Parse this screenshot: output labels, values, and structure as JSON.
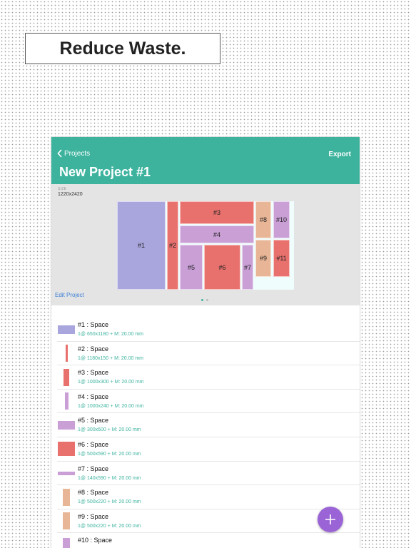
{
  "headline": "Reduce Waste.",
  "nav": {
    "back_label": "Projects",
    "export_label": "Export",
    "title": "New Project #1"
  },
  "preview": {
    "size_caption": "SIZE",
    "size_value": "1220x2420",
    "edit_label": "Edit Project",
    "pager_pages": 2,
    "active_page": 1
  },
  "colors": {
    "accent": "#3db39e",
    "purple": "#a9a5dd",
    "red": "#e8716d",
    "lilac": "#c99fd6",
    "peach": "#e8b596",
    "fab": "#9b64d6"
  },
  "pieces": [
    {
      "label": "#1",
      "color": "#a9a5dd"
    },
    {
      "label": "#2",
      "color": "#e8716d"
    },
    {
      "label": "#3",
      "color": "#e8716d"
    },
    {
      "label": "#4",
      "color": "#c99fd6"
    },
    {
      "label": "#5",
      "color": "#c99fd6"
    },
    {
      "label": "#6",
      "color": "#e8716d"
    },
    {
      "label": "#7",
      "color": "#c99fd6"
    },
    {
      "label": "#8",
      "color": "#e8b596"
    },
    {
      "label": "#9",
      "color": "#e8b596"
    },
    {
      "label": "#10",
      "color": "#c99fd6"
    },
    {
      "label": "#11",
      "color": "#e8716d"
    }
  ],
  "items": [
    {
      "title": "#1 : Space",
      "detail": "1@ 650x1180 + M: 20.00 mm",
      "color": "#a9a5dd"
    },
    {
      "title": "#2 : Space",
      "detail": "1@ 1180x150 + M: 20.00 mm",
      "color": "#e8716d"
    },
    {
      "title": "#3 : Space",
      "detail": "1@ 1000x300 + M: 20.00 mm",
      "color": "#e8716d"
    },
    {
      "title": "#4 : Space",
      "detail": "1@ 1000x240 + M: 20.00 mm",
      "color": "#c99fd6"
    },
    {
      "title": "#5 : Space",
      "detail": "1@ 300x600 + M: 20.00 mm",
      "color": "#c99fd6"
    },
    {
      "title": "#6 : Space",
      "detail": "1@ 500x590 + M: 20.00 mm",
      "color": "#e8716d"
    },
    {
      "title": "#7 : Space",
      "detail": "1@ 140x590 + M: 20.00 mm",
      "color": "#c99fd6"
    },
    {
      "title": "#8 : Space",
      "detail": "1@ 500x220 + M: 20.00 mm",
      "color": "#e8b596"
    },
    {
      "title": "#9 : Space",
      "detail": "1@ 500x220 + M: 20.00 mm",
      "color": "#e8b596"
    },
    {
      "title": "#10 : Space",
      "detail": "",
      "color": "#c99fd6"
    }
  ],
  "fab_icon": "plus-icon"
}
